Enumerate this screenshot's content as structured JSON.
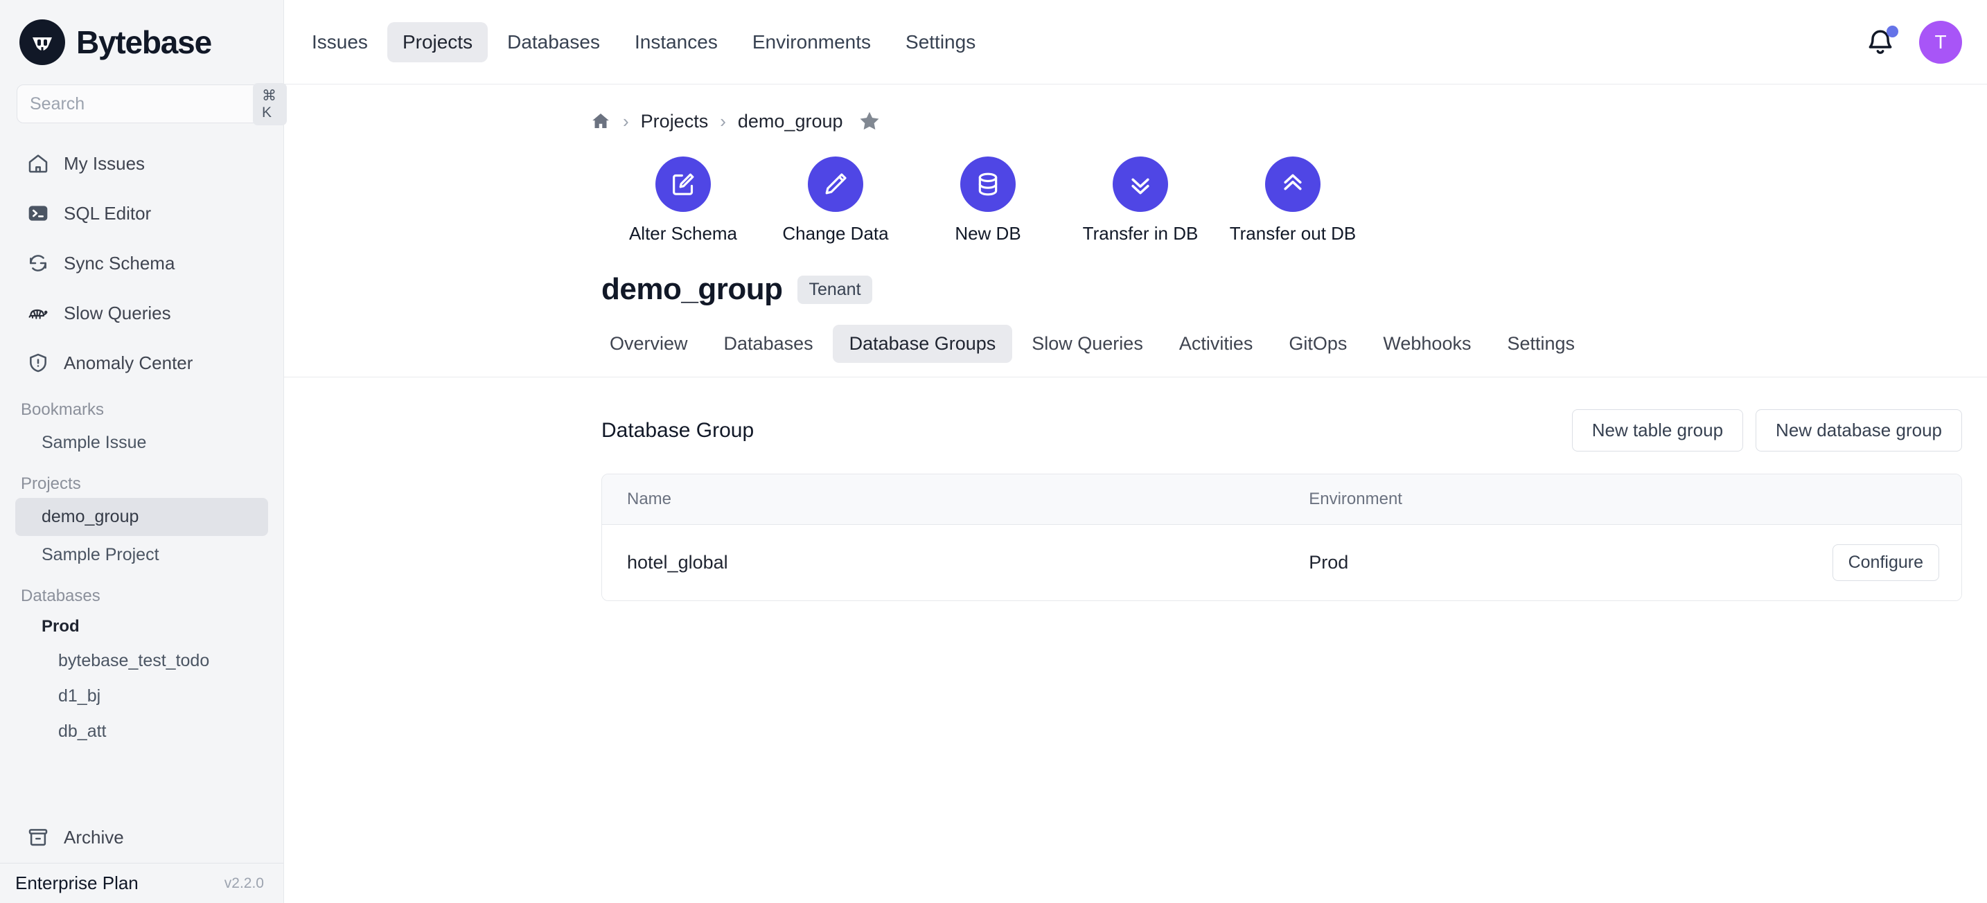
{
  "brand": {
    "name": "Bytebase",
    "logo_icon": "bytebase-mascot-logo"
  },
  "search": {
    "placeholder": "Search",
    "shortcut": "⌘ K",
    "value": ""
  },
  "sidebar": {
    "nav": [
      {
        "label": "My Issues",
        "icon": "home-icon"
      },
      {
        "label": "SQL Editor",
        "icon": "terminal-icon"
      },
      {
        "label": "Sync Schema",
        "icon": "refresh-sync-icon"
      },
      {
        "label": "Slow Queries",
        "icon": "turtle-icon"
      },
      {
        "label": "Anomaly Center",
        "icon": "shield-alert-icon"
      }
    ],
    "bookmarks": {
      "heading": "Bookmarks",
      "items": [
        {
          "label": "Sample Issue"
        }
      ]
    },
    "projects": {
      "heading": "Projects",
      "items": [
        {
          "label": "demo_group",
          "active": true
        },
        {
          "label": "Sample Project",
          "active": false
        }
      ]
    },
    "databases": {
      "heading": "Databases",
      "environment": "Prod",
      "items": [
        {
          "label": "bytebase_test_todo"
        },
        {
          "label": "d1_bj"
        },
        {
          "label": "db_att"
        }
      ]
    },
    "archive": {
      "label": "Archive",
      "icon": "archive-box-icon"
    },
    "plan": {
      "name": "Enterprise Plan",
      "version": "v2.2.0"
    }
  },
  "topbar": {
    "nav": [
      {
        "label": "Issues",
        "active": false
      },
      {
        "label": "Projects",
        "active": true
      },
      {
        "label": "Databases",
        "active": false
      },
      {
        "label": "Instances",
        "active": false
      },
      {
        "label": "Environments",
        "active": false
      },
      {
        "label": "Settings",
        "active": false
      }
    ],
    "notification_icon": "bell-icon",
    "has_notification_dot": true,
    "avatar_initial": "T",
    "avatar_color": "#a855f7"
  },
  "breadcrumb": {
    "home_icon": "home-icon",
    "sep": "›",
    "projects": "Projects",
    "current": "demo_group",
    "star_icon": "star-filled-icon"
  },
  "quick_actions": {
    "accent_color": "#4f46e5",
    "items": [
      {
        "label": "Alter Schema",
        "icon": "edit-square-icon"
      },
      {
        "label": "Change Data",
        "icon": "pencil-icon"
      },
      {
        "label": "New DB",
        "icon": "database-icon"
      },
      {
        "label": "Transfer in DB",
        "icon": "chevrons-down-icon"
      },
      {
        "label": "Transfer out DB",
        "icon": "chevrons-up-icon"
      }
    ]
  },
  "project": {
    "title": "demo_group",
    "badge": "Tenant",
    "tabs": [
      {
        "label": "Overview",
        "active": false
      },
      {
        "label": "Databases",
        "active": false
      },
      {
        "label": "Database Groups",
        "active": true
      },
      {
        "label": "Slow Queries",
        "active": false
      },
      {
        "label": "Activities",
        "active": false
      },
      {
        "label": "GitOps",
        "active": false
      },
      {
        "label": "Webhooks",
        "active": false
      },
      {
        "label": "Settings",
        "active": false
      }
    ]
  },
  "panel": {
    "title": "Database Group",
    "new_table_group": "New table group",
    "new_database_group": "New database group",
    "table": {
      "columns": [
        "Name",
        "Environment",
        ""
      ],
      "rows": [
        {
          "name": "hotel_global",
          "environment": "Prod",
          "action": "Configure"
        }
      ]
    }
  }
}
